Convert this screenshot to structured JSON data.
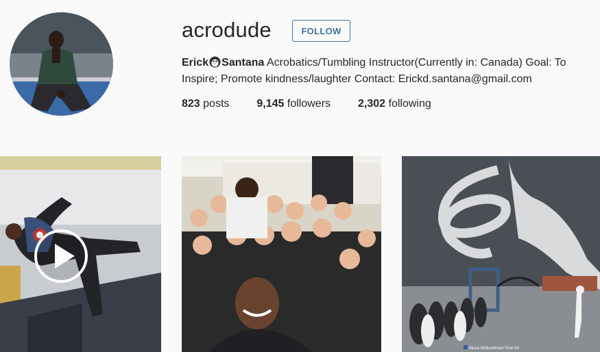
{
  "profile": {
    "username": "acrodude",
    "follow_label": "FOLLOW",
    "full_name_first": "Erick",
    "full_name_last": "Santana",
    "bio_line1_rest": " Acrobatics/Tumbling Instructor(Currently in: Canada) Goal: To",
    "bio_line2": "Inspire; Promote kindness/laughter Contact: Erickd.santana@gmail.com"
  },
  "stats": {
    "posts_count": "823",
    "posts_label": " posts",
    "followers_count": "9,145",
    "followers_label": " followers",
    "following_count": "2,302",
    "following_label": " following"
  },
  "posts": {
    "art_credit": "Muna Abdurahman Fine Art"
  },
  "colors": {
    "accent": "#3f729b",
    "background": "#fafafa",
    "text": "#262626"
  },
  "icons": [
    "play-icon",
    "penguin-face-emoji"
  ]
}
